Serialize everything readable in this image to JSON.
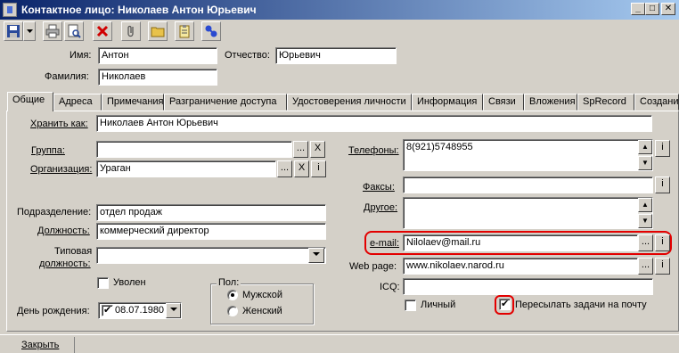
{
  "window": {
    "title": "Контактное лицо: Николаев Антон Юрьевич",
    "minimize": "_",
    "maximize": "□",
    "close": "✕"
  },
  "toolbar": {
    "icons": [
      "save-icon",
      "dropdown-arrow-icon",
      "print-icon",
      "print-preview-icon",
      "delete-icon",
      "attach-icon",
      "folder-icon",
      "clipboard-icon",
      "link-icon"
    ]
  },
  "name": {
    "first_label": "Имя:",
    "first_value": "Антон",
    "middle_label": "Отчество:",
    "middle_value": "Юрьевич",
    "last_label": "Фамилия:",
    "last_value": "Николаев"
  },
  "tabs": [
    {
      "label": "Общие"
    },
    {
      "label": "Адреса"
    },
    {
      "label": "Примечания"
    },
    {
      "label": "Разграничение доступа"
    },
    {
      "label": "Удостоверения личности"
    },
    {
      "label": "Информация"
    },
    {
      "label": "Связи"
    },
    {
      "label": "Вложения"
    },
    {
      "label": "SpRecord"
    },
    {
      "label": "Создани"
    }
  ],
  "general": {
    "store_as_label": "Хранить как:",
    "store_as_value": "Николаев Антон Юрьевич",
    "group_label": "Группа:",
    "group_value": "",
    "org_label": "Организация:",
    "org_value": "Ураган",
    "dept_label": "Подразделение:",
    "dept_value": "отдел продаж",
    "position_label": "Должность:",
    "position_value": "коммерческий директор",
    "typical_position_label_1": "Типовая",
    "typical_position_label_2": "должность:",
    "typical_position_value": "",
    "fired_label": "Уволен",
    "birthday_label": "День рождения:",
    "birthday_value": "08.07.1980",
    "gender_group_label": "Пол:",
    "gender_male": "Мужской",
    "gender_female": "Женский",
    "phones_label": "Телефоны:",
    "phones_value": "8(921)5748955",
    "faxes_label": "Факсы:",
    "faxes_value": "",
    "other_label": "Другое:",
    "other_value": "",
    "email_label": "e-mail:",
    "email_value": "Nilolaev@mail.ru",
    "web_label": "Web page:",
    "web_value": "www.nikolaev.narod.ru",
    "icq_label": "ICQ:",
    "icq_value": "",
    "personal_label": "Личный",
    "forward_tasks_label": "Пересылать задачи на почту",
    "browse_btn": "...",
    "clear_btn": "X",
    "info_btn": "i"
  },
  "footer": {
    "close_label": "Закрыть"
  },
  "colors": {
    "title_start": "#0a246a",
    "title_end": "#a6caf0",
    "face": "#d4d0c8",
    "highlight": "#e30000"
  }
}
